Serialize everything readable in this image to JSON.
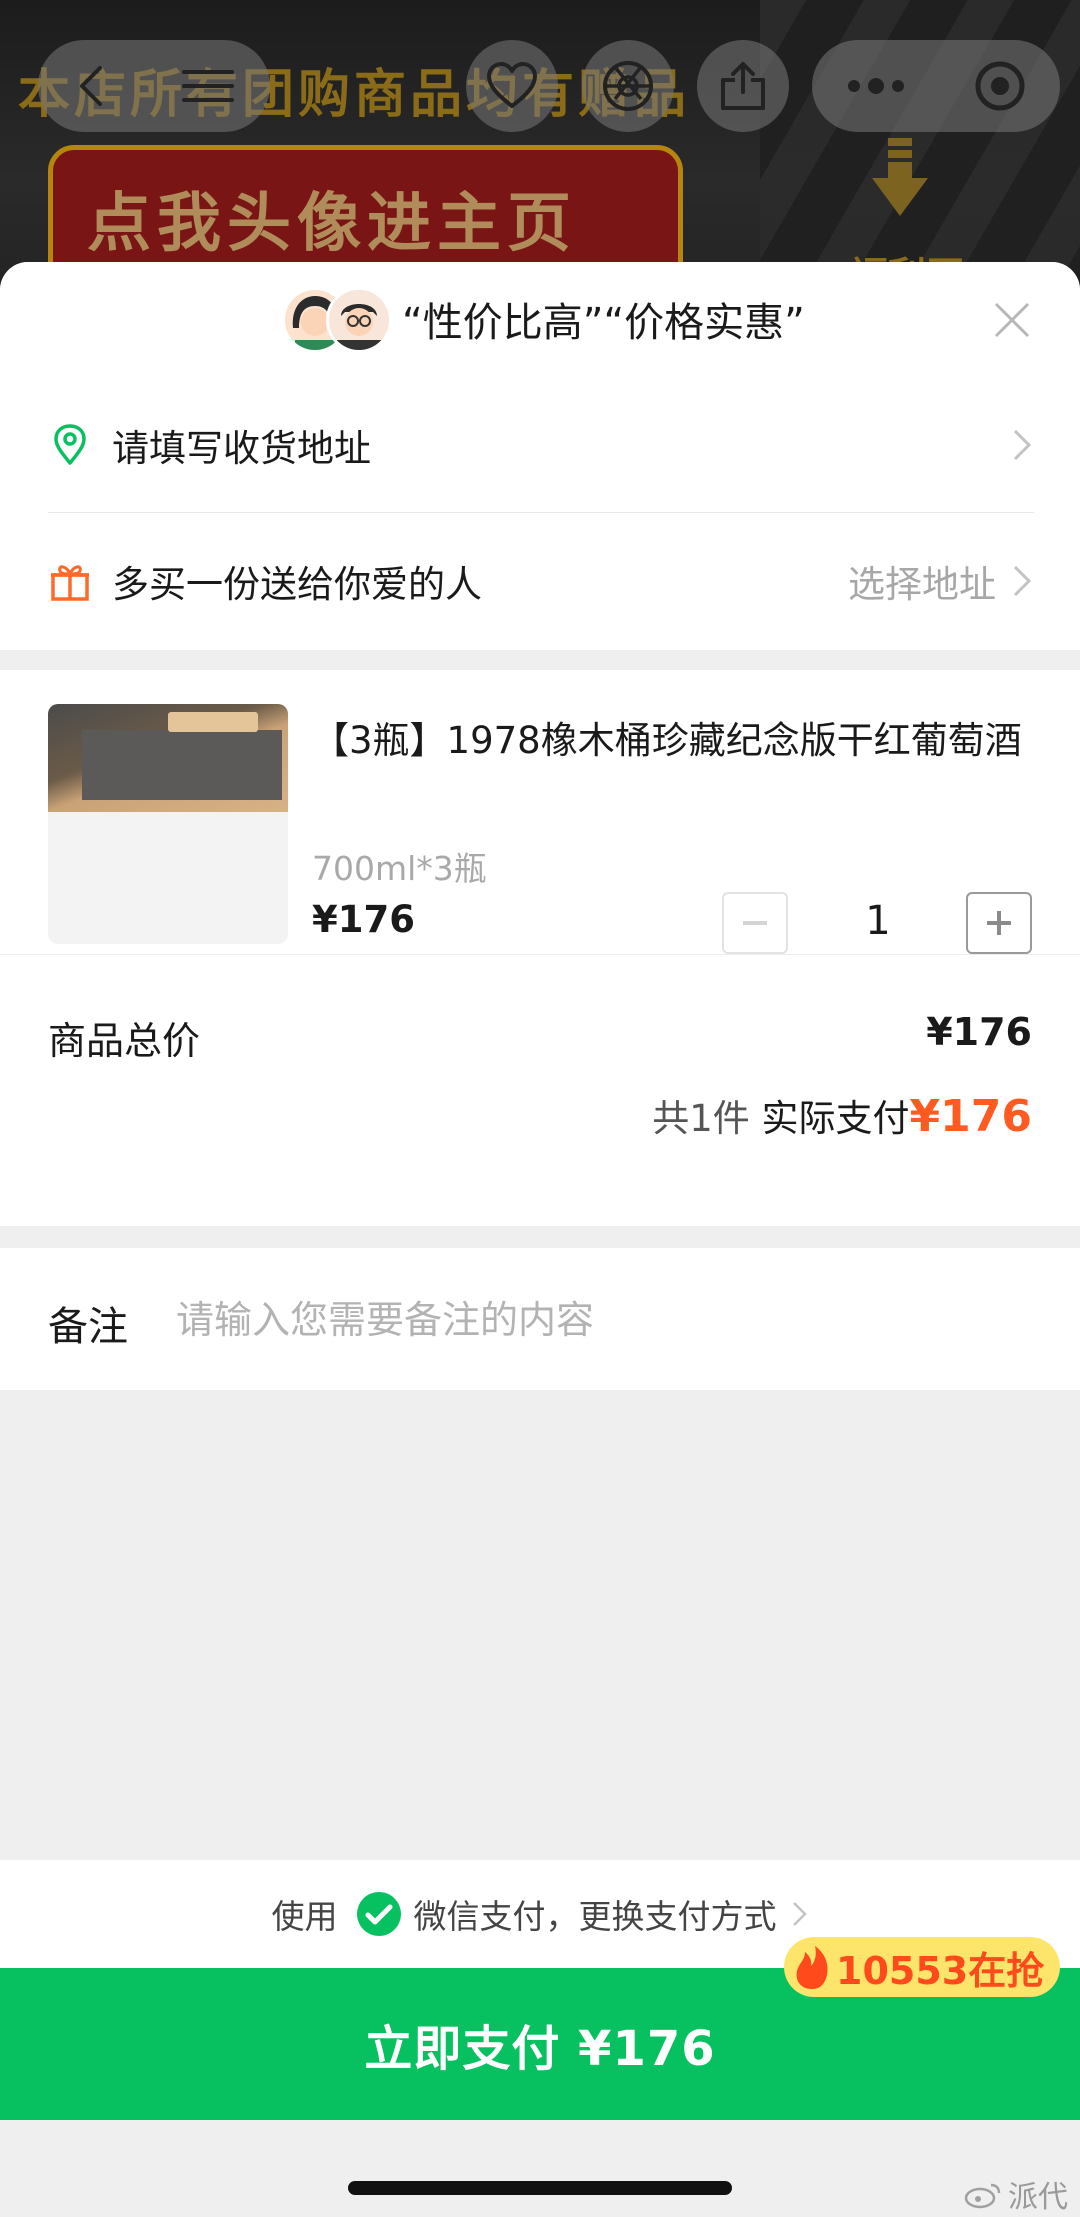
{
  "background": {
    "marquee": "本店所有团购商品均有赠品",
    "banner": "点我头像进主页",
    "side_text": "福利区"
  },
  "sheet": {
    "header_title": "“性价比高”“价格实惠”",
    "address_prompt": "请填写收货地址",
    "gift_label": "多买一份送给你爱的人",
    "gift_action": "选择地址"
  },
  "product": {
    "title": "【3瓶】1978橡木桶珍藏纪念版干红葡萄酒",
    "spec": "700ml*3瓶",
    "price": "¥176",
    "quantity": "1"
  },
  "summary": {
    "total_label": "商品总价",
    "total_value": "¥176",
    "count_text": "共1件",
    "pay_label": "实际支付",
    "pay_amount": "¥176"
  },
  "note": {
    "label": "备注",
    "placeholder": "请输入您需要备注的内容"
  },
  "payment": {
    "prefix": "使用",
    "method": "微信支付，更换支付方式"
  },
  "cta": {
    "label": "立即支付 ¥176",
    "badge": "10553在抢"
  },
  "watermark": "派代",
  "colors": {
    "accent_green": "#07c160",
    "price_orange": "#ff5a1f",
    "badge_yellow": "#fde56b"
  }
}
